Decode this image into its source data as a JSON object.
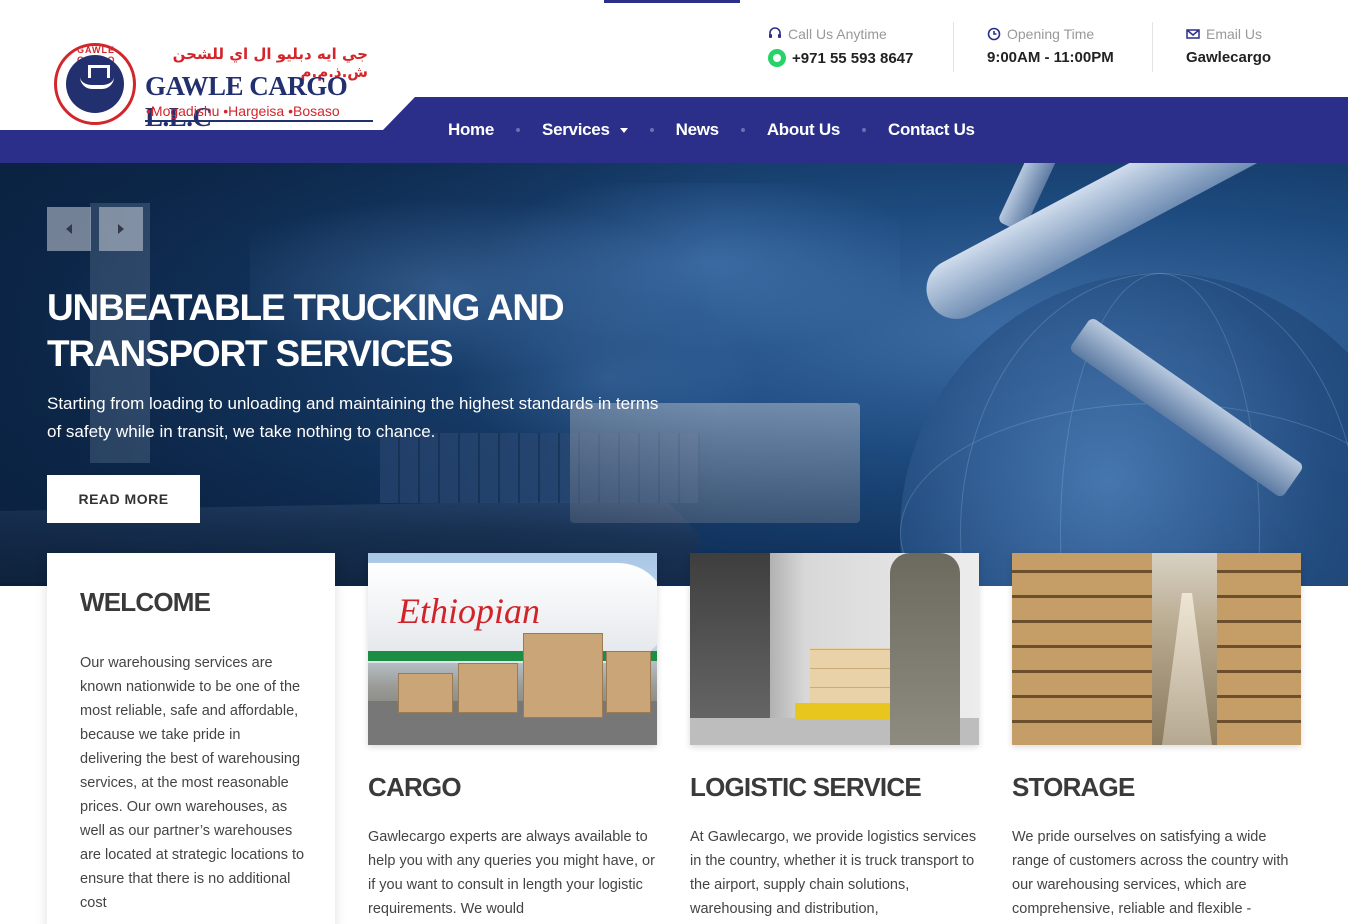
{
  "header": {
    "logo": {
      "arabic": "جي ايه دبليو ال اي للشحن ش.ذ.م.م",
      "name": "GAWLE CARGO L.L.C",
      "cities": "•Mogadishu •Hargeisa •Bosaso",
      "ring_text": "GAWLE CARGO"
    },
    "phone": {
      "label": "Call Us Anytime",
      "value": "+971 55 593 8647"
    },
    "hours": {
      "label": "Opening Time",
      "value": "9:00AM - 11:00PM"
    },
    "email": {
      "label": "Email Us",
      "value": "Gawlecargo"
    }
  },
  "nav": {
    "items": [
      {
        "label": "Home"
      },
      {
        "label": "Services",
        "has_dropdown": true
      },
      {
        "label": "News"
      },
      {
        "label": "About Us"
      },
      {
        "label": "Contact Us"
      }
    ]
  },
  "hero": {
    "title_line1": "UNBEATABLE TRUCKING AND",
    "title_line2": "TRANSPORT SERVICES",
    "text": "Starting from loading to unloading and maintaining the highest standards in terms of safety while in transit, we take nothing to chance.",
    "button": "READ MORE"
  },
  "welcome": {
    "title": "WELCOME",
    "text": "Our warehousing services are known nationwide to be one of the most reliable, safe and affordable, because we take pride in delivering the best of warehousing services, at the most reasonable prices. Our own warehouses, as well as our partner’s warehouses are located at strategic locations to ensure that there is no additional cost"
  },
  "cards": [
    {
      "title": "CARGO",
      "image_text": "Ethiopian",
      "text": "Gawlecargo experts are always available to help you with any queries you might have, or if you want to consult in length your logistic requirements. We would"
    },
    {
      "title": "LOGISTIC SERVICE",
      "text": "At Gawlecargo, we provide logistics services in the country, whether it is truck transport to the airport, supply chain solutions, warehousing and distribution,"
    },
    {
      "title": "STORAGE",
      "text": "We pride ourselves on satisfying a wide range of customers across the country with our warehousing services, which are comprehensive, reliable and flexible -"
    }
  ],
  "colors": {
    "brand_blue": "#2b2f8a",
    "logo_red": "#d3262b",
    "whatsapp_green": "#25d366"
  }
}
